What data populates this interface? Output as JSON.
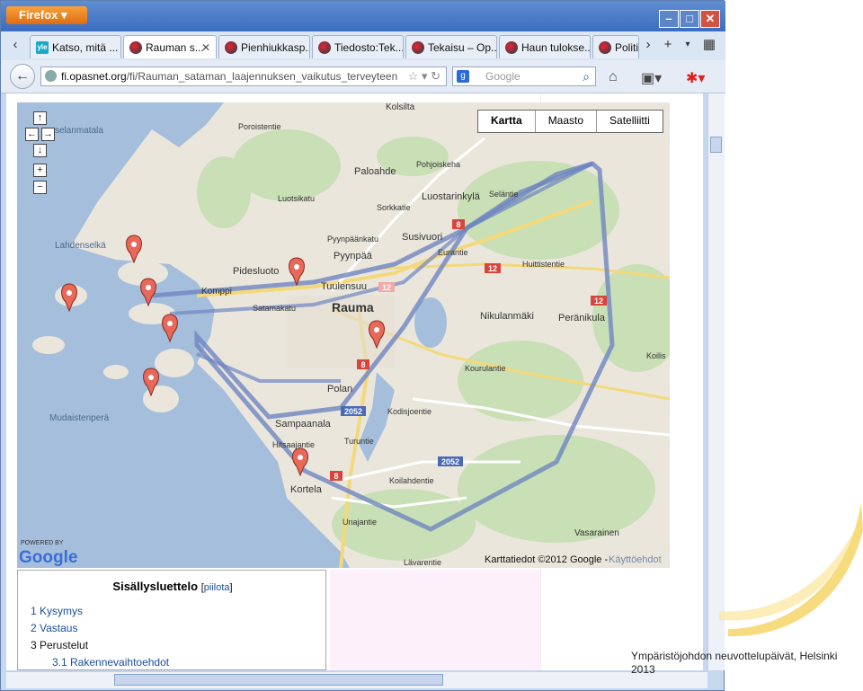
{
  "browser": {
    "app_button": "Firefox",
    "window_controls": [
      "–",
      "□",
      "✕"
    ],
    "tabs": [
      {
        "label": "Katso, mitä ...",
        "favicon": "yle-icon"
      },
      {
        "label": "Rauman s...",
        "favicon": "opasnet-icon",
        "active": true
      },
      {
        "label": "Pienhiukkasp...",
        "favicon": "opasnet-icon"
      },
      {
        "label": "Tiedosto:Tek...",
        "favicon": "opasnet-icon"
      },
      {
        "label": "Tekaisu – Op...",
        "favicon": "opasnet-icon"
      },
      {
        "label": "Haun tulokse...",
        "favicon": "opasnet-icon"
      },
      {
        "label": "Politiil",
        "favicon": "opasnet-icon"
      }
    ],
    "url": {
      "host": "fi.opasnet.org",
      "path": "/fi/Rauman_sataman_laajennuksen_vaikutus_terveyteen"
    },
    "search_placeholder": "Google"
  },
  "map": {
    "type_buttons": [
      "Kartta",
      "Maasto",
      "Satelliitti"
    ],
    "place_labels": [
      {
        "t": "Kolsilta"
      },
      {
        "t": "Paloahde"
      },
      {
        "t": "Pohjoiskeha"
      },
      {
        "t": "Luostarinkylä"
      },
      {
        "t": "Susivuori"
      },
      {
        "t": "Pyynpää"
      },
      {
        "t": "Pyynpäänkatu"
      },
      {
        "t": "Pidesluoto"
      },
      {
        "t": "Tuulensuu"
      },
      {
        "t": "Komppi"
      },
      {
        "t": "Rauma"
      },
      {
        "t": "Satamakatu"
      },
      {
        "t": "Nikulanmäki"
      },
      {
        "t": "Peränikula"
      },
      {
        "t": "Huittistentie"
      },
      {
        "t": "Lahdenselkä"
      },
      {
        "t": "Polan"
      },
      {
        "t": "Sampaanala"
      },
      {
        "t": "Kodisjoentie"
      },
      {
        "t": "Kourulantie"
      },
      {
        "t": "Mudaistenperä"
      },
      {
        "t": "Kortela"
      },
      {
        "t": "Koilahdentie"
      },
      {
        "t": "Vasarainen"
      },
      {
        "t": "Hitsaajantie"
      },
      {
        "t": "Turuntie"
      },
      {
        "t": "Unajantie"
      },
      {
        "t": "Luotsikatu"
      },
      {
        "t": "Sorkkatie"
      },
      {
        "t": "Poroistentie"
      },
      {
        "t": "Seläntie"
      },
      {
        "t": "Eurantie"
      }
    ],
    "road_badges": [
      {
        "t": "8"
      },
      {
        "t": "12"
      },
      {
        "t": "12"
      },
      {
        "t": "12"
      },
      {
        "t": "8"
      },
      {
        "t": "2052"
      },
      {
        "t": "2052"
      },
      {
        "t": "8"
      }
    ],
    "partial_top_left": "selanmatala",
    "partial_right": "Koilis",
    "partial_bottom": "Lävarentie",
    "powered_by": "POWERED BY",
    "google_logo": "Google",
    "attribution": "Karttatiedot ©2012 Google -",
    "terms_link": "Käyttöehdot",
    "colors": {
      "water": "#a4bedc",
      "land": "#eae6dc",
      "green": "#c9dfb5",
      "route": "#6f86c2",
      "marker": "#e8685a"
    }
  },
  "toc": {
    "title": "Sisällysluettelo",
    "hide_open": "[",
    "hide_link": "piilota",
    "hide_close": "]",
    "items": [
      {
        "label": "1 Kysymys"
      },
      {
        "label": "2 Vastaus"
      },
      {
        "label": "3 Perustelut"
      },
      {
        "label": "3.1 Rakennevaihtoehdot"
      }
    ]
  },
  "footer": {
    "line1": "Ympäristöjohdon neuvottelupäivät, Helsinki",
    "line2": "2013"
  }
}
